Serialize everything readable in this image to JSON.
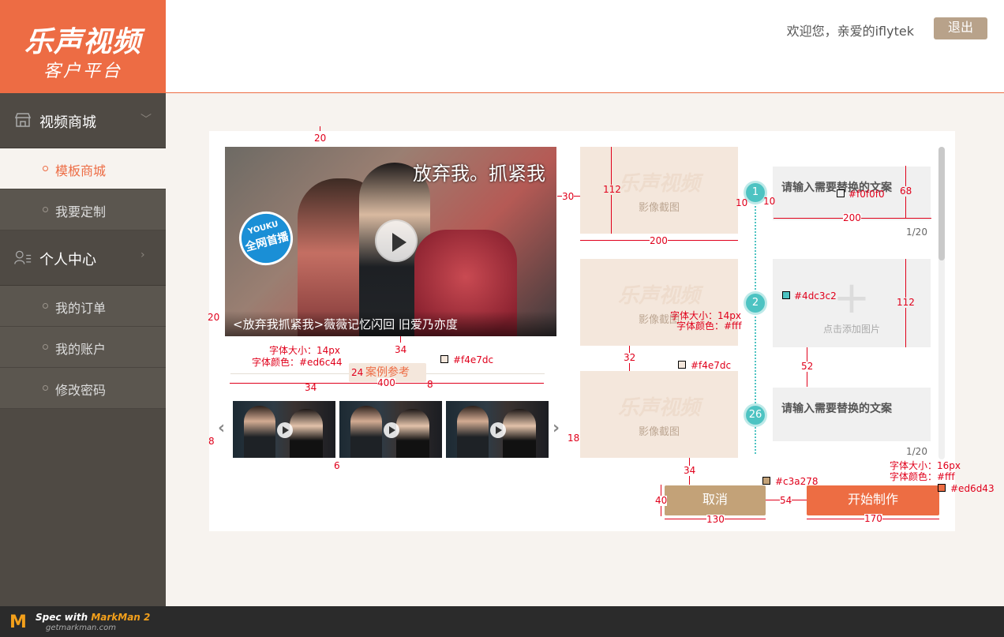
{
  "brand": {
    "name": "乐声视频",
    "subtitle": "客户平台"
  },
  "header": {
    "welcome": "欢迎您，亲爱的iflytek",
    "logout": "退出"
  },
  "sidebar": {
    "sections": [
      {
        "label": "视频商城",
        "icon": "store-icon",
        "chevron": "chevron-down-icon"
      },
      {
        "label": "个人中心",
        "icon": "user-list-icon",
        "chevron": "chevron-right-icon"
      }
    ],
    "items": [
      {
        "label": "模板商城",
        "active": true
      },
      {
        "label": "我要定制",
        "active": false
      },
      {
        "label": "我的订单",
        "active": false
      },
      {
        "label": "我的账户",
        "active": false
      },
      {
        "label": "修改密码",
        "active": false
      }
    ]
  },
  "video": {
    "title_overlay": "放弃我。抓紧我",
    "badge_top": "YOUKU",
    "badge_main": "全网首播",
    "caption": "<放弃我抓紧我>薇薇记忆闪回 旧爱乃亦度"
  },
  "case_tag": "案例参考",
  "thumbnails_count": 3,
  "slots": [
    {
      "step": "1",
      "shot_watermark": "乐声视频",
      "shot_label": "影像截图",
      "text_placeholder": "请输入需要替换的文案",
      "counter": "1/20"
    },
    {
      "step": "2",
      "shot_watermark": "乐声视频",
      "shot_label": "影像截图",
      "add_label": "点击添加图片",
      "plus": "+"
    },
    {
      "step": "26",
      "shot_watermark": "乐声视频",
      "shot_label": "影像截图",
      "text_placeholder": "请输入需要替换的文案",
      "counter": "1/20"
    }
  ],
  "buttons": {
    "cancel": "取消",
    "start": "开始制作"
  },
  "annotations": {
    "d20": "20",
    "d30": "30",
    "d112": "112",
    "d200": "200",
    "d10a": "10",
    "d10b": "10",
    "d68": "68",
    "d200b": "200",
    "c_f0f0f0": "#f0f0f0",
    "c_4dc3c2": "#4dc3c2",
    "d112b": "112",
    "s14": "字体大小：14px",
    "cfff": "字体颜色：#fff",
    "d20l": "20",
    "d34": "34",
    "d24": "24",
    "d8": "8",
    "d400": "400",
    "d34b": "34",
    "f14": "字体大小：14px",
    "ced6c44": "字体颜色：#ed6c44",
    "c_f4e7dc": "#f4e7dc",
    "d32": "32",
    "c_f4e7dc2": "#f4e7dc",
    "d52": "52",
    "d8l": "8",
    "d6": "6",
    "d18": "18",
    "d34c": "34",
    "c_c3a278": "#c3a278",
    "d40": "40",
    "d54": "54",
    "d130": "130",
    "d170": "170",
    "f16": "字体大小：16px",
    "cfff2": "字体颜色：#fff",
    "c_ed6d43": "#ed6d43"
  },
  "colors": {
    "accent": "#ed6c44",
    "teal": "#4dc3c2",
    "tan": "#c3a278",
    "orange": "#ed6d43",
    "sidebar": "#4f4a44"
  },
  "footer": {
    "line1_prefix": "Spec with ",
    "line1_brand": "MarkMan 2",
    "line2": "getmarkman.com",
    "logo": "markman-logo-icon"
  }
}
